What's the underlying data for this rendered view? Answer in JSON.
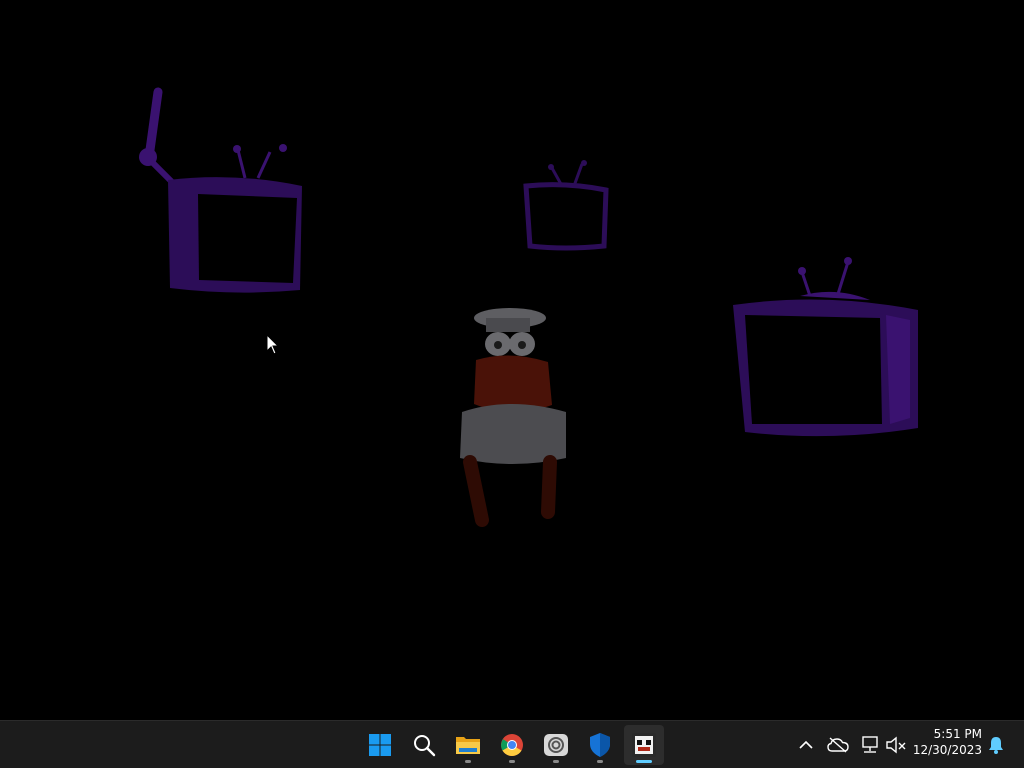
{
  "desktop": {
    "scene": "pizza-tower-title-screen",
    "colors": {
      "tv_purple": "#3a1270",
      "chef_red": "#4a1208",
      "chef_white": "#5e5e62"
    }
  },
  "taskbar": {
    "pinned": [
      {
        "id": "start",
        "icon": "windows-start-icon",
        "running": false,
        "active": false
      },
      {
        "id": "search",
        "icon": "search-icon",
        "running": false,
        "active": false
      },
      {
        "id": "file-explorer",
        "icon": "folder-icon",
        "running": true,
        "active": false
      },
      {
        "id": "chrome",
        "icon": "chrome-icon",
        "running": true,
        "active": false
      },
      {
        "id": "cloud-app",
        "icon": "cloud-app-icon",
        "running": true,
        "active": false
      },
      {
        "id": "security",
        "icon": "shield-icon",
        "running": true,
        "active": false
      },
      {
        "id": "game",
        "icon": "pizza-tower-icon",
        "running": true,
        "active": true
      }
    ],
    "tray": [
      {
        "icon": "chevron-up-icon"
      },
      {
        "icon": "onedrive-offline-icon"
      },
      {
        "icon": "network-icon"
      },
      {
        "icon": "volume-muted-icon"
      },
      {
        "icon": "notification-bell-icon"
      }
    ],
    "clock": {
      "time": "5:51 PM",
      "date": "12/30/2023"
    },
    "colors": {
      "accent": "#60cdff",
      "background": "#1c1c1c"
    }
  }
}
